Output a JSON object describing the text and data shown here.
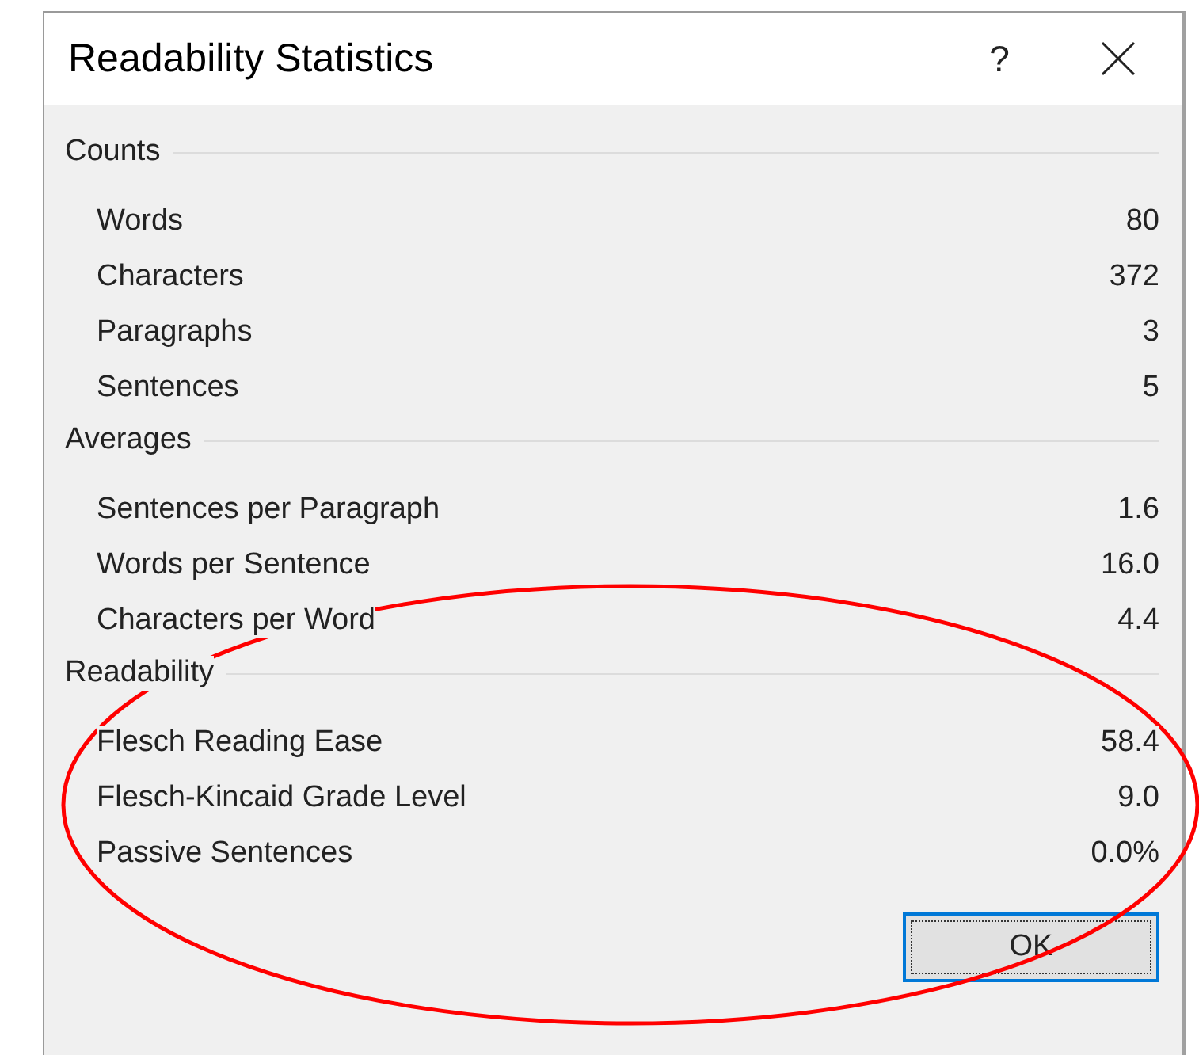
{
  "window": {
    "title": "Readability Statistics",
    "help": "?"
  },
  "sections": [
    {
      "title": "Counts",
      "rows": [
        {
          "label": "Words",
          "value": "80"
        },
        {
          "label": "Characters",
          "value": "372"
        },
        {
          "label": "Paragraphs",
          "value": "3"
        },
        {
          "label": "Sentences",
          "value": "5"
        }
      ]
    },
    {
      "title": "Averages",
      "rows": [
        {
          "label": "Sentences per Paragraph",
          "value": "1.6"
        },
        {
          "label": "Words per Sentence",
          "value": "16.0"
        },
        {
          "label": "Characters per Word",
          "value": "4.4"
        }
      ]
    },
    {
      "title": "Readability",
      "rows": [
        {
          "label": "Flesch Reading Ease",
          "value": "58.4"
        },
        {
          "label": "Flesch-Kincaid Grade Level",
          "value": "9.0"
        },
        {
          "label": "Passive Sentences",
          "value": "0.0%"
        }
      ]
    }
  ],
  "buttons": [
    {
      "label": "OK",
      "focused": true
    }
  ]
}
